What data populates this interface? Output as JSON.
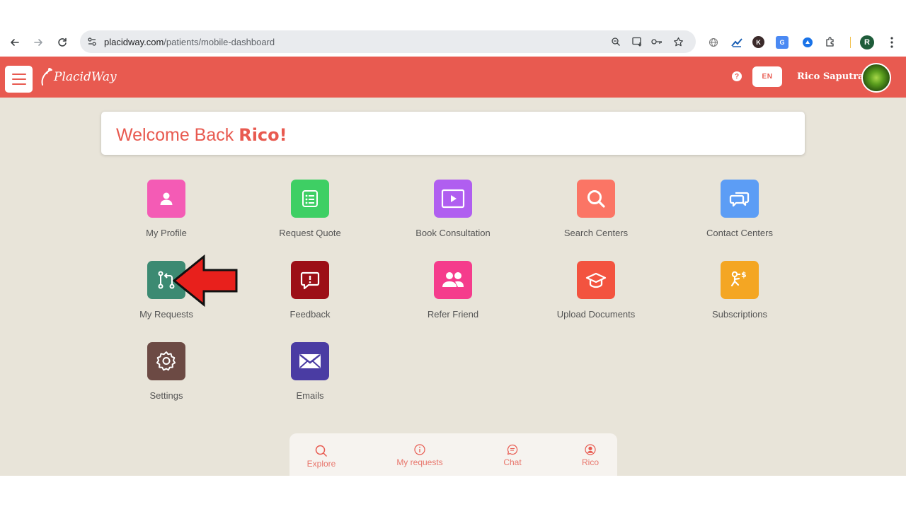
{
  "browser": {
    "url_host": "placidway.com",
    "url_path": "/patients/mobile-dashboard",
    "profile_initial": "R"
  },
  "header": {
    "logo_text": "PlacidWay",
    "help_glyph": "?",
    "lang": "EN",
    "user_name": "Rico Saputra"
  },
  "welcome": {
    "prefix": "Welcome Back ",
    "name": "Rico!"
  },
  "tiles": [
    {
      "label": "My Profile",
      "icon": "user-icon",
      "color": "#f45bb5"
    },
    {
      "label": "Request Quote",
      "icon": "list-icon",
      "color": "#3ecf64"
    },
    {
      "label": "Book Consultation",
      "icon": "play-icon",
      "color": "#b05ef0"
    },
    {
      "label": "Search Centers",
      "icon": "search-icon",
      "color": "#fb7565"
    },
    {
      "label": "Contact Centers",
      "icon": "chat-icon",
      "color": "#5c9df5"
    },
    {
      "label": "My Requests",
      "icon": "git-compare-icon",
      "color": "#3c8a72"
    },
    {
      "label": "Feedback",
      "icon": "feedback-icon",
      "color": "#9c0f17"
    },
    {
      "label": "Refer Friend",
      "icon": "users-icon",
      "color": "#f53c8c"
    },
    {
      "label": "Upload Documents",
      "icon": "graduation-cap-icon",
      "color": "#f3533f"
    },
    {
      "label": "Subscriptions",
      "icon": "subscriptions-icon",
      "color": "#f4a623"
    },
    {
      "label": "Settings",
      "icon": "gear-icon",
      "color": "#6c4a44"
    },
    {
      "label": "Emails",
      "icon": "mail-icon",
      "color": "#4a3ca3"
    }
  ],
  "bottom_nav": [
    {
      "label": "Explore",
      "icon": "search-icon"
    },
    {
      "label": "My requests",
      "icon": "info-icon"
    },
    {
      "label": "Chat",
      "icon": "chat-icon"
    },
    {
      "label": "Rico",
      "icon": "user-circle-icon"
    }
  ]
}
